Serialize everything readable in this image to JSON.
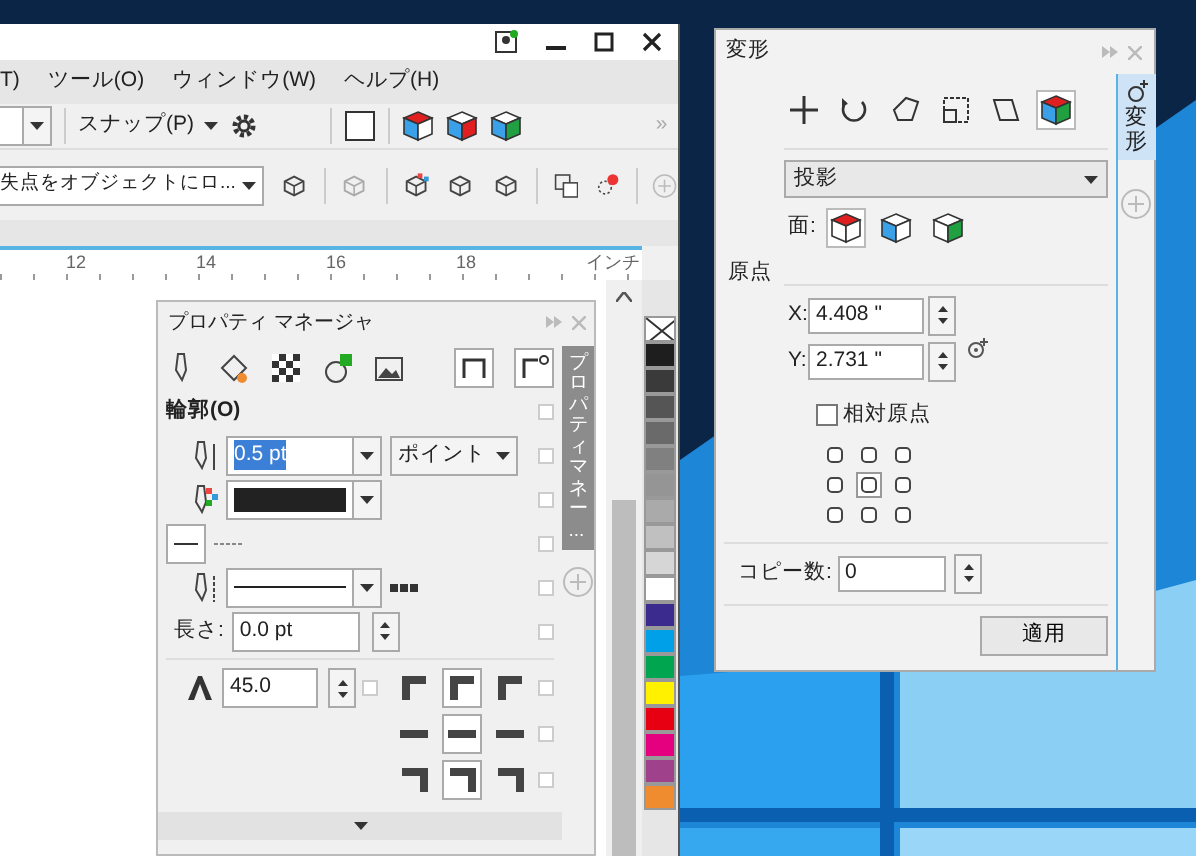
{
  "main_window": {
    "menu": [
      "T)",
      "ツール(O)",
      "ウィンドウ(W)",
      "ヘルプ(H)"
    ],
    "toolbar": {
      "snap": "スナップ(P)",
      "more": "»",
      "vanishing_point": "失点をオブジェクトにロ..."
    },
    "ruler": {
      "ticks": [
        "12",
        "14",
        "16",
        "18"
      ],
      "unit": "インチ"
    },
    "property_manager": {
      "title": "プロパティ マネージャ",
      "section": "輪郭(O)",
      "width": {
        "value": "0.5 pt",
        "highlighted": true
      },
      "units": "ポイント",
      "length_label": "長さ:",
      "length": "0.0 pt",
      "miter": "45.0",
      "corners": [
        [
          {
            "selected": false
          },
          {
            "selected": true
          },
          {
            "selected": false
          }
        ],
        [
          {
            "selected": false
          },
          {
            "selected": true
          },
          {
            "selected": false
          }
        ],
        [
          {
            "selected": false
          },
          {
            "selected": true
          },
          {
            "selected": false
          }
        ]
      ],
      "side_tab": "プロパティマネー..."
    },
    "palette": [
      {
        "kind": "none"
      },
      {
        "color": "#1e1e1e"
      },
      {
        "color": "#3a3a3a"
      },
      {
        "color": "#555555"
      },
      {
        "color": "#6a6a6a"
      },
      {
        "color": "#808080"
      },
      {
        "color": "#959595"
      },
      {
        "color": "#aaaaaa"
      },
      {
        "color": "#c0c0c0"
      },
      {
        "color": "#d6d6d6"
      },
      {
        "color": "#ffffff"
      },
      {
        "color": "#3b2b8f"
      },
      {
        "color": "#00a0e9"
      },
      {
        "color": "#00a550"
      },
      {
        "color": "#fff100"
      },
      {
        "color": "#e60012"
      },
      {
        "color": "#e4007f"
      },
      {
        "color": "#a0418c"
      },
      {
        "color": "#f08c30"
      }
    ]
  },
  "transform": {
    "title": "変形",
    "tabs": [
      {
        "selected": false
      },
      {
        "selected": false
      },
      {
        "selected": false
      },
      {
        "selected": false
      },
      {
        "selected": false
      },
      {
        "selected": true
      }
    ],
    "mode": "投影",
    "face_label": "面:",
    "faces": [
      {
        "selected": true
      },
      {
        "selected": false
      },
      {
        "selected": false
      }
    ],
    "origin_label": "原点",
    "x_label": "X:",
    "x": "4.408 \"",
    "y_label": "Y:",
    "y": "2.731 \"",
    "relative": {
      "label": "相対原点",
      "checked": false
    },
    "anchors": [
      {
        "selected": false
      },
      {
        "selected": false
      },
      {
        "selected": false
      },
      {
        "selected": false
      },
      {
        "selected": true
      },
      {
        "selected": false
      },
      {
        "selected": false
      },
      {
        "selected": false
      },
      {
        "selected": false
      }
    ],
    "copies_label": "コピー数:",
    "copies": "0",
    "apply": "適用",
    "side_tab": "変形"
  }
}
